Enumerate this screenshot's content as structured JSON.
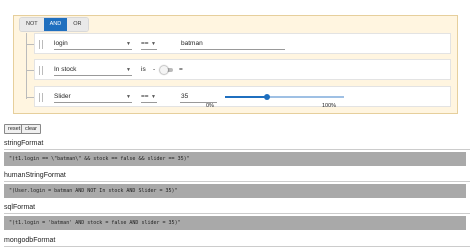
{
  "conjunctions": [
    {
      "label": "NOT",
      "active": false
    },
    {
      "label": "AND",
      "active": true
    },
    {
      "label": "OR",
      "active": false
    }
  ],
  "rules": [
    {
      "field": "login",
      "operator": "==",
      "value": "batman"
    },
    {
      "field": "In stock",
      "operator": "is",
      "operator_extra": "-",
      "value_label": "false"
    },
    {
      "field": "Slider",
      "operator": "==",
      "value": "35",
      "slider_value": 35,
      "slider_min_label": "0%",
      "slider_max_label": "100%"
    }
  ],
  "buttons": {
    "reset": "reset",
    "clear": "clear"
  },
  "outputs": [
    {
      "title": "stringFormat",
      "code": "\"(t1.login == \\\"batman\\\" && stock == false && slider == 35)\""
    },
    {
      "title": "humanStringFormat",
      "code": "\"(User.login = batman AND NOT In stock AND Slider = 35)\""
    },
    {
      "title": "sqlFormat",
      "code": "\"(t1.login = 'batman' AND stock = false AND slider = 35)\""
    },
    {
      "title": "mongodbFormat",
      "code": ""
    }
  ],
  "colors": {
    "accent": "#1f6fbf",
    "panel_bg": "#fff5e0",
    "code_bg": "#a9a9a9"
  }
}
